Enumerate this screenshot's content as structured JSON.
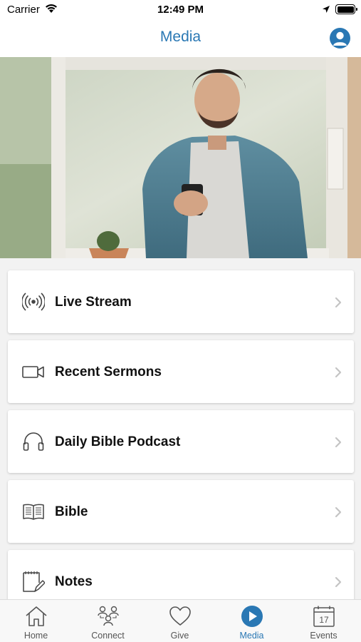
{
  "status_bar": {
    "carrier": "Carrier",
    "time": "12:49 PM"
  },
  "nav": {
    "title": "Media",
    "profile_icon": "person-circle-icon"
  },
  "hero": {
    "description_icon": "photo-man-with-phone"
  },
  "menu": {
    "items": [
      {
        "label": "Live Stream",
        "icon": "broadcast-icon"
      },
      {
        "label": "Recent Sermons",
        "icon": "video-camera-icon"
      },
      {
        "label": "Daily Bible Podcast",
        "icon": "headphones-icon"
      },
      {
        "label": "Bible",
        "icon": "open-book-icon"
      },
      {
        "label": "Notes",
        "icon": "notepad-icon"
      }
    ]
  },
  "tab_bar": {
    "active": "Media",
    "accent": "#2a78b4",
    "tabs": [
      {
        "label": "Home",
        "icon": "home-icon"
      },
      {
        "label": "Connect",
        "icon": "people-icon"
      },
      {
        "label": "Give",
        "icon": "heart-icon"
      },
      {
        "label": "Media",
        "icon": "play-circle-icon"
      },
      {
        "label": "Events",
        "icon": "calendar-icon"
      }
    ],
    "events_day": "17"
  }
}
